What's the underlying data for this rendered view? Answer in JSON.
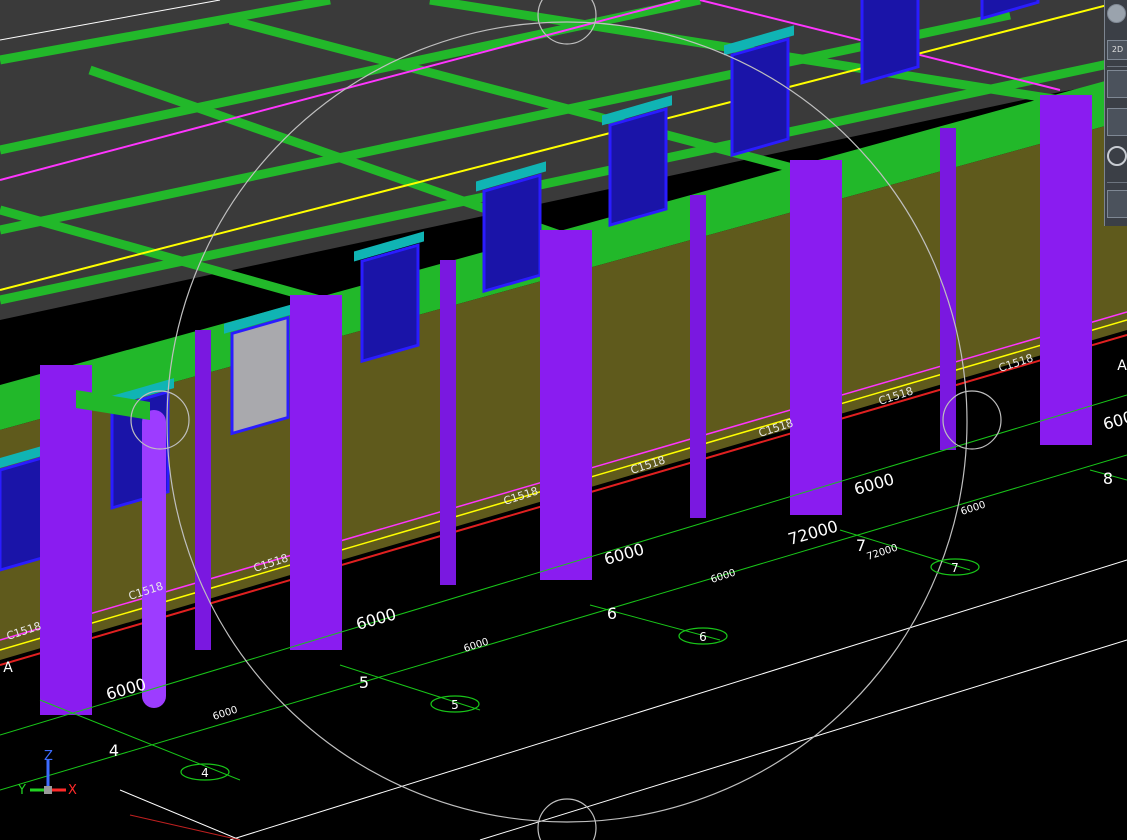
{
  "app": {
    "view_cube_label": "2D"
  },
  "dimensions": {
    "overall": "72000",
    "bay": "6000"
  },
  "axis_labels": {
    "row": "A",
    "col4": "4",
    "col5": "5",
    "col6": "6",
    "col7": "7",
    "col8": "8"
  },
  "window_tag": "C1518",
  "ucs": {
    "x": "X",
    "y": "Y",
    "z": "Z"
  },
  "colors": {
    "background": "#000000",
    "roof": "#3a3a3a",
    "beam": "#22b82a",
    "column": "#8a1cf0",
    "wall": "#5f5a1c",
    "window": "#1a14a8",
    "lintel": "#10b4b4",
    "axis_line": "#19c519",
    "magenta_line": "#ff35ff",
    "yellow_line": "#ffff00",
    "red_line": "#e02020"
  },
  "icons": [
    "navigation-wheel-icon",
    "view-cube-icon",
    "orbit-icon",
    "ucs-icon"
  ]
}
